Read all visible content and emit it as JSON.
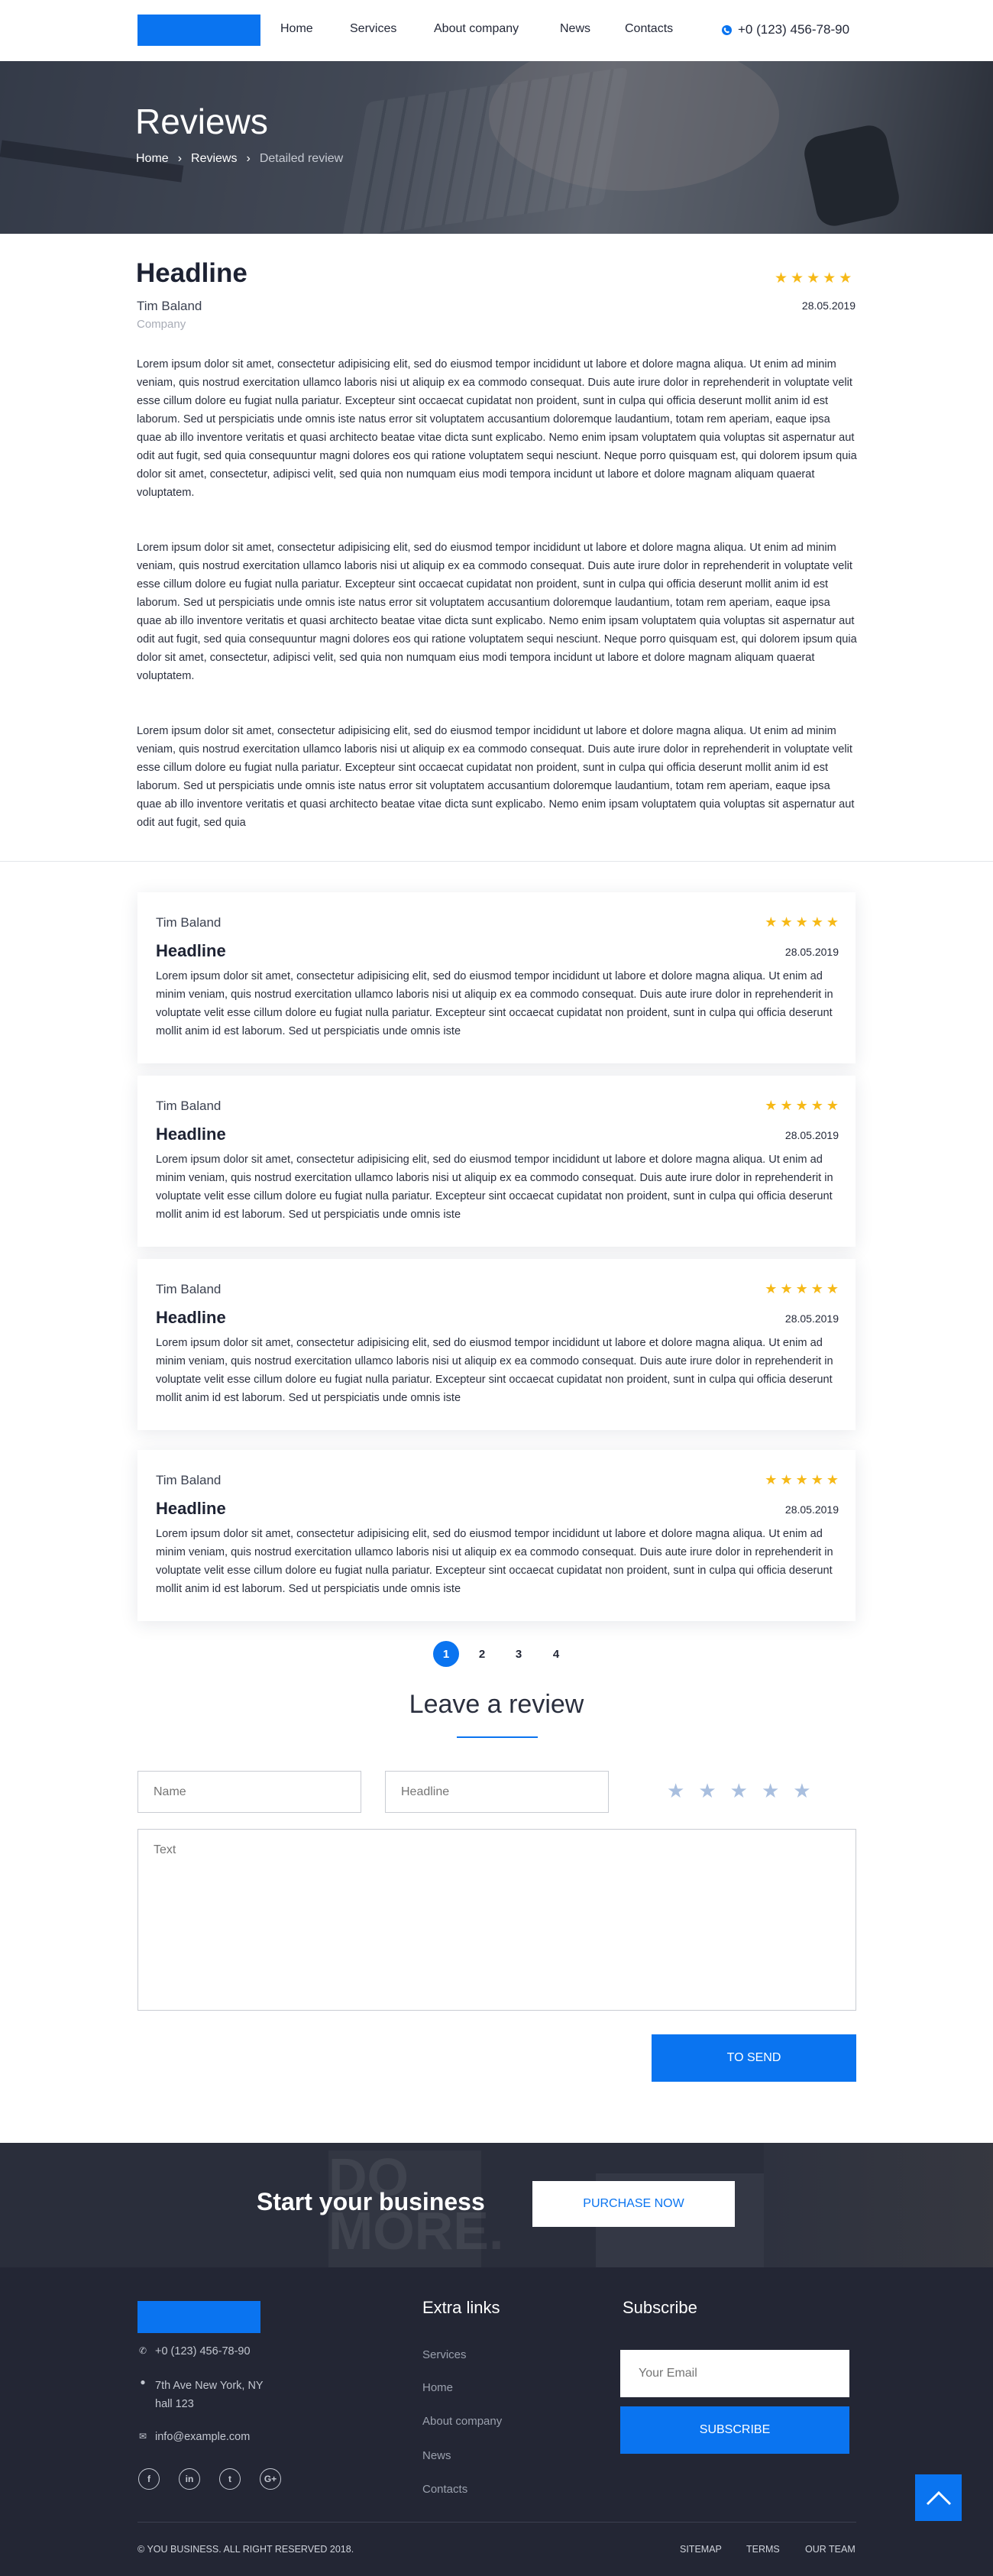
{
  "header": {
    "nav": [
      "Home",
      "Services",
      "About company",
      "News",
      "Contacts"
    ],
    "phone": "+0 (123) 456-78-90"
  },
  "hero": {
    "title": "Reviews",
    "breadcrumbs": [
      "Home",
      "Reviews",
      "Detailed review"
    ]
  },
  "review": {
    "title": "Headline",
    "author": "Tim Baland",
    "company": "Company",
    "date": "28.05.2019",
    "rating": 5,
    "paragraphs": [
      "Lorem ipsum dolor sit amet, consectetur adipisicing elit, sed do eiusmod tempor incididunt ut labore et dolore magna aliqua. Ut enim ad minim veniam, quis nostrud exercitation ullamco laboris nisi ut aliquip ex ea commodo consequat. Duis aute irure dolor in reprehenderit in voluptate velit esse cillum dolore eu fugiat nulla pariatur. Excepteur sint occaecat cupidatat non proident, sunt in culpa qui officia deserunt mollit anim id est laborum. Sed ut perspiciatis unde omnis iste natus error sit voluptatem accusantium doloremque laudantium, totam rem aperiam, eaque ipsa quae ab illo inventore veritatis et quasi architecto beatae vitae dicta sunt explicabo. Nemo enim ipsam voluptatem quia voluptas sit aspernatur aut odit aut fugit, sed quia consequuntur magni dolores eos qui ratione voluptatem sequi nesciunt. Neque porro quisquam est, qui dolorem ipsum quia dolor sit amet, consectetur, adipisci velit, sed quia non numquam eius modi tempora incidunt ut labore et dolore magnam aliquam quaerat voluptatem.",
      "Lorem ipsum dolor sit amet, consectetur adipisicing elit, sed do eiusmod tempor incididunt ut labore et dolore magna aliqua. Ut enim ad minim veniam, quis nostrud exercitation ullamco laboris nisi ut aliquip ex ea commodo consequat. Duis aute irure dolor in reprehenderit in voluptate velit esse cillum dolore eu fugiat nulla pariatur. Excepteur sint occaecat cupidatat non proident, sunt in culpa qui officia deserunt mollit anim id est laborum. Sed ut perspiciatis unde omnis iste natus error sit voluptatem accusantium doloremque laudantium, totam rem aperiam, eaque ipsa quae ab illo inventore veritatis et quasi architecto beatae vitae dicta sunt explicabo. Nemo enim ipsam voluptatem quia voluptas sit aspernatur aut odit aut fugit, sed quia consequuntur magni dolores eos qui ratione voluptatem sequi nesciunt. Neque porro quisquam est, qui dolorem ipsum quia dolor sit amet, consectetur, adipisci velit, sed quia non numquam eius modi tempora incidunt ut labore et dolore magnam aliquam quaerat voluptatem.",
      "Lorem ipsum dolor sit amet, consectetur adipisicing elit, sed do eiusmod tempor incididunt ut labore et dolore magna aliqua. Ut enim ad minim veniam, quis nostrud exercitation ullamco laboris nisi ut aliquip ex ea commodo consequat. Duis aute irure dolor in reprehenderit in voluptate velit esse cillum dolore eu fugiat nulla pariatur. Excepteur sint occaecat cupidatat non proident, sunt in culpa qui officia deserunt mollit anim id est laborum. Sed ut perspiciatis unde omnis iste natus error sit voluptatem accusantium doloremque laudantium, totam rem aperiam, eaque ipsa quae ab illo inventore veritatis et quasi architecto beatae vitae dicta sunt explicabo. Nemo enim ipsam voluptatem quia voluptas sit aspernatur aut odit aut fugit, sed quia"
    ]
  },
  "cards": [
    {
      "author": "Tim Baland",
      "title": "Headline",
      "date": "28.05.2019",
      "rating": 5,
      "text": "Lorem ipsum dolor sit amet, consectetur adipisicing elit, sed do eiusmod tempor incididunt ut labore et dolore magna aliqua. Ut enim ad minim veniam, quis nostrud exercitation ullamco laboris nisi ut aliquip ex ea commodo consequat. Duis aute irure dolor in reprehenderit in voluptate velit esse cillum dolore eu fugiat nulla pariatur. Excepteur sint occaecat cupidatat non proident, sunt in culpa qui officia deserunt mollit anim id est laborum. Sed ut perspiciatis unde omnis iste"
    },
    {
      "author": "Tim Baland",
      "title": "Headline",
      "date": "28.05.2019",
      "rating": 5,
      "text": "Lorem ipsum dolor sit amet, consectetur adipisicing elit, sed do eiusmod tempor incididunt ut labore et dolore magna aliqua. Ut enim ad minim veniam, quis nostrud exercitation ullamco laboris nisi ut aliquip ex ea commodo consequat. Duis aute irure dolor in reprehenderit in voluptate velit esse cillum dolore eu fugiat nulla pariatur. Excepteur sint occaecat cupidatat non proident, sunt in culpa qui officia deserunt mollit anim id est laborum. Sed ut perspiciatis unde omnis iste"
    },
    {
      "author": "Tim Baland",
      "title": "Headline",
      "date": "28.05.2019",
      "rating": 5,
      "text": "Lorem ipsum dolor sit amet, consectetur adipisicing elit, sed do eiusmod tempor incididunt ut labore et dolore magna aliqua. Ut enim ad minim veniam, quis nostrud exercitation ullamco laboris nisi ut aliquip ex ea commodo consequat. Duis aute irure dolor in reprehenderit in voluptate velit esse cillum dolore eu fugiat nulla pariatur. Excepteur sint occaecat cupidatat non proident, sunt in culpa qui officia deserunt mollit anim id est laborum. Sed ut perspiciatis unde omnis iste"
    },
    {
      "author": "Tim Baland",
      "title": "Headline",
      "date": "28.05.2019",
      "rating": 5,
      "text": "Lorem ipsum dolor sit amet, consectetur adipisicing elit, sed do eiusmod tempor incididunt ut labore et dolore magna aliqua. Ut enim ad minim veniam, quis nostrud exercitation ullamco laboris nisi ut aliquip ex ea commodo consequat. Duis aute irure dolor in reprehenderit in voluptate velit esse cillum dolore eu fugiat nulla pariatur. Excepteur sint occaecat cupidatat non proident, sunt in culpa qui officia deserunt mollit anim id est laborum. Sed ut perspiciatis unde omnis iste"
    }
  ],
  "pagination": {
    "pages": [
      "1",
      "2",
      "3",
      "4"
    ],
    "current": "1"
  },
  "form": {
    "title": "Leave a review",
    "name_placeholder": "Name",
    "headline_placeholder": "Headline",
    "text_placeholder": "Text",
    "rating": 0,
    "send_label": "TO SEND"
  },
  "cta": {
    "text": "Start your business",
    "button": "PURCHASE NOW",
    "bg_text": "DO MORE."
  },
  "footer": {
    "phone": "+0 (123) 456-78-90",
    "address_line1": "7th Ave New York, NY",
    "address_line2": "hall 123",
    "email": "info@example.com",
    "social": [
      "facebook-icon",
      "linkedin-icon",
      "twitter-icon",
      "google-plus-icon"
    ],
    "links_title": "Extra links",
    "links": [
      "Services",
      "Home",
      "About company",
      "News",
      "Contacts"
    ],
    "subscribe_title": "Subscribe",
    "email_placeholder": "Your Email",
    "subscribe_button": "SUBSCRIBE",
    "copyright": "© YOU BUSINESS. ALL RIGHT RESERVED 2018.",
    "bottom_links": [
      "SITEMAP",
      "TERMS",
      "OUR TEAM"
    ]
  },
  "colors": {
    "accent": "#0a74f0",
    "star": "#f6b917",
    "footer_bg": "#232634",
    "star_empty": "#a9bfdf"
  }
}
